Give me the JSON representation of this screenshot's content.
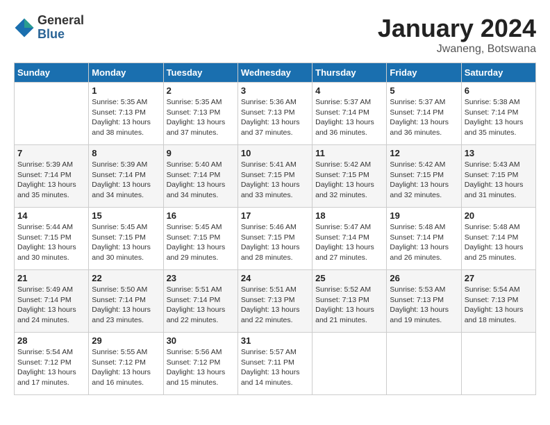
{
  "header": {
    "logo_general": "General",
    "logo_blue": "Blue",
    "month_title": "January 2024",
    "location": "Jwaneng, Botswana"
  },
  "weekdays": [
    "Sunday",
    "Monday",
    "Tuesday",
    "Wednesday",
    "Thursday",
    "Friday",
    "Saturday"
  ],
  "weeks": [
    [
      {
        "day": "",
        "sunrise": "",
        "sunset": "",
        "daylight": ""
      },
      {
        "day": "1",
        "sunrise": "Sunrise: 5:35 AM",
        "sunset": "Sunset: 7:13 PM",
        "daylight": "Daylight: 13 hours and 38 minutes."
      },
      {
        "day": "2",
        "sunrise": "Sunrise: 5:35 AM",
        "sunset": "Sunset: 7:13 PM",
        "daylight": "Daylight: 13 hours and 37 minutes."
      },
      {
        "day": "3",
        "sunrise": "Sunrise: 5:36 AM",
        "sunset": "Sunset: 7:13 PM",
        "daylight": "Daylight: 13 hours and 37 minutes."
      },
      {
        "day": "4",
        "sunrise": "Sunrise: 5:37 AM",
        "sunset": "Sunset: 7:14 PM",
        "daylight": "Daylight: 13 hours and 36 minutes."
      },
      {
        "day": "5",
        "sunrise": "Sunrise: 5:37 AM",
        "sunset": "Sunset: 7:14 PM",
        "daylight": "Daylight: 13 hours and 36 minutes."
      },
      {
        "day": "6",
        "sunrise": "Sunrise: 5:38 AM",
        "sunset": "Sunset: 7:14 PM",
        "daylight": "Daylight: 13 hours and 35 minutes."
      }
    ],
    [
      {
        "day": "7",
        "sunrise": "Sunrise: 5:39 AM",
        "sunset": "Sunset: 7:14 PM",
        "daylight": "Daylight: 13 hours and 35 minutes."
      },
      {
        "day": "8",
        "sunrise": "Sunrise: 5:39 AM",
        "sunset": "Sunset: 7:14 PM",
        "daylight": "Daylight: 13 hours and 34 minutes."
      },
      {
        "day": "9",
        "sunrise": "Sunrise: 5:40 AM",
        "sunset": "Sunset: 7:14 PM",
        "daylight": "Daylight: 13 hours and 34 minutes."
      },
      {
        "day": "10",
        "sunrise": "Sunrise: 5:41 AM",
        "sunset": "Sunset: 7:15 PM",
        "daylight": "Daylight: 13 hours and 33 minutes."
      },
      {
        "day": "11",
        "sunrise": "Sunrise: 5:42 AM",
        "sunset": "Sunset: 7:15 PM",
        "daylight": "Daylight: 13 hours and 32 minutes."
      },
      {
        "day": "12",
        "sunrise": "Sunrise: 5:42 AM",
        "sunset": "Sunset: 7:15 PM",
        "daylight": "Daylight: 13 hours and 32 minutes."
      },
      {
        "day": "13",
        "sunrise": "Sunrise: 5:43 AM",
        "sunset": "Sunset: 7:15 PM",
        "daylight": "Daylight: 13 hours and 31 minutes."
      }
    ],
    [
      {
        "day": "14",
        "sunrise": "Sunrise: 5:44 AM",
        "sunset": "Sunset: 7:15 PM",
        "daylight": "Daylight: 13 hours and 30 minutes."
      },
      {
        "day": "15",
        "sunrise": "Sunrise: 5:45 AM",
        "sunset": "Sunset: 7:15 PM",
        "daylight": "Daylight: 13 hours and 30 minutes."
      },
      {
        "day": "16",
        "sunrise": "Sunrise: 5:45 AM",
        "sunset": "Sunset: 7:15 PM",
        "daylight": "Daylight: 13 hours and 29 minutes."
      },
      {
        "day": "17",
        "sunrise": "Sunrise: 5:46 AM",
        "sunset": "Sunset: 7:15 PM",
        "daylight": "Daylight: 13 hours and 28 minutes."
      },
      {
        "day": "18",
        "sunrise": "Sunrise: 5:47 AM",
        "sunset": "Sunset: 7:14 PM",
        "daylight": "Daylight: 13 hours and 27 minutes."
      },
      {
        "day": "19",
        "sunrise": "Sunrise: 5:48 AM",
        "sunset": "Sunset: 7:14 PM",
        "daylight": "Daylight: 13 hours and 26 minutes."
      },
      {
        "day": "20",
        "sunrise": "Sunrise: 5:48 AM",
        "sunset": "Sunset: 7:14 PM",
        "daylight": "Daylight: 13 hours and 25 minutes."
      }
    ],
    [
      {
        "day": "21",
        "sunrise": "Sunrise: 5:49 AM",
        "sunset": "Sunset: 7:14 PM",
        "daylight": "Daylight: 13 hours and 24 minutes."
      },
      {
        "day": "22",
        "sunrise": "Sunrise: 5:50 AM",
        "sunset": "Sunset: 7:14 PM",
        "daylight": "Daylight: 13 hours and 23 minutes."
      },
      {
        "day": "23",
        "sunrise": "Sunrise: 5:51 AM",
        "sunset": "Sunset: 7:14 PM",
        "daylight": "Daylight: 13 hours and 22 minutes."
      },
      {
        "day": "24",
        "sunrise": "Sunrise: 5:51 AM",
        "sunset": "Sunset: 7:13 PM",
        "daylight": "Daylight: 13 hours and 22 minutes."
      },
      {
        "day": "25",
        "sunrise": "Sunrise: 5:52 AM",
        "sunset": "Sunset: 7:13 PM",
        "daylight": "Daylight: 13 hours and 21 minutes."
      },
      {
        "day": "26",
        "sunrise": "Sunrise: 5:53 AM",
        "sunset": "Sunset: 7:13 PM",
        "daylight": "Daylight: 13 hours and 19 minutes."
      },
      {
        "day": "27",
        "sunrise": "Sunrise: 5:54 AM",
        "sunset": "Sunset: 7:13 PM",
        "daylight": "Daylight: 13 hours and 18 minutes."
      }
    ],
    [
      {
        "day": "28",
        "sunrise": "Sunrise: 5:54 AM",
        "sunset": "Sunset: 7:12 PM",
        "daylight": "Daylight: 13 hours and 17 minutes."
      },
      {
        "day": "29",
        "sunrise": "Sunrise: 5:55 AM",
        "sunset": "Sunset: 7:12 PM",
        "daylight": "Daylight: 13 hours and 16 minutes."
      },
      {
        "day": "30",
        "sunrise": "Sunrise: 5:56 AM",
        "sunset": "Sunset: 7:12 PM",
        "daylight": "Daylight: 13 hours and 15 minutes."
      },
      {
        "day": "31",
        "sunrise": "Sunrise: 5:57 AM",
        "sunset": "Sunset: 7:11 PM",
        "daylight": "Daylight: 13 hours and 14 minutes."
      },
      {
        "day": "",
        "sunrise": "",
        "sunset": "",
        "daylight": ""
      },
      {
        "day": "",
        "sunrise": "",
        "sunset": "",
        "daylight": ""
      },
      {
        "day": "",
        "sunrise": "",
        "sunset": "",
        "daylight": ""
      }
    ]
  ]
}
